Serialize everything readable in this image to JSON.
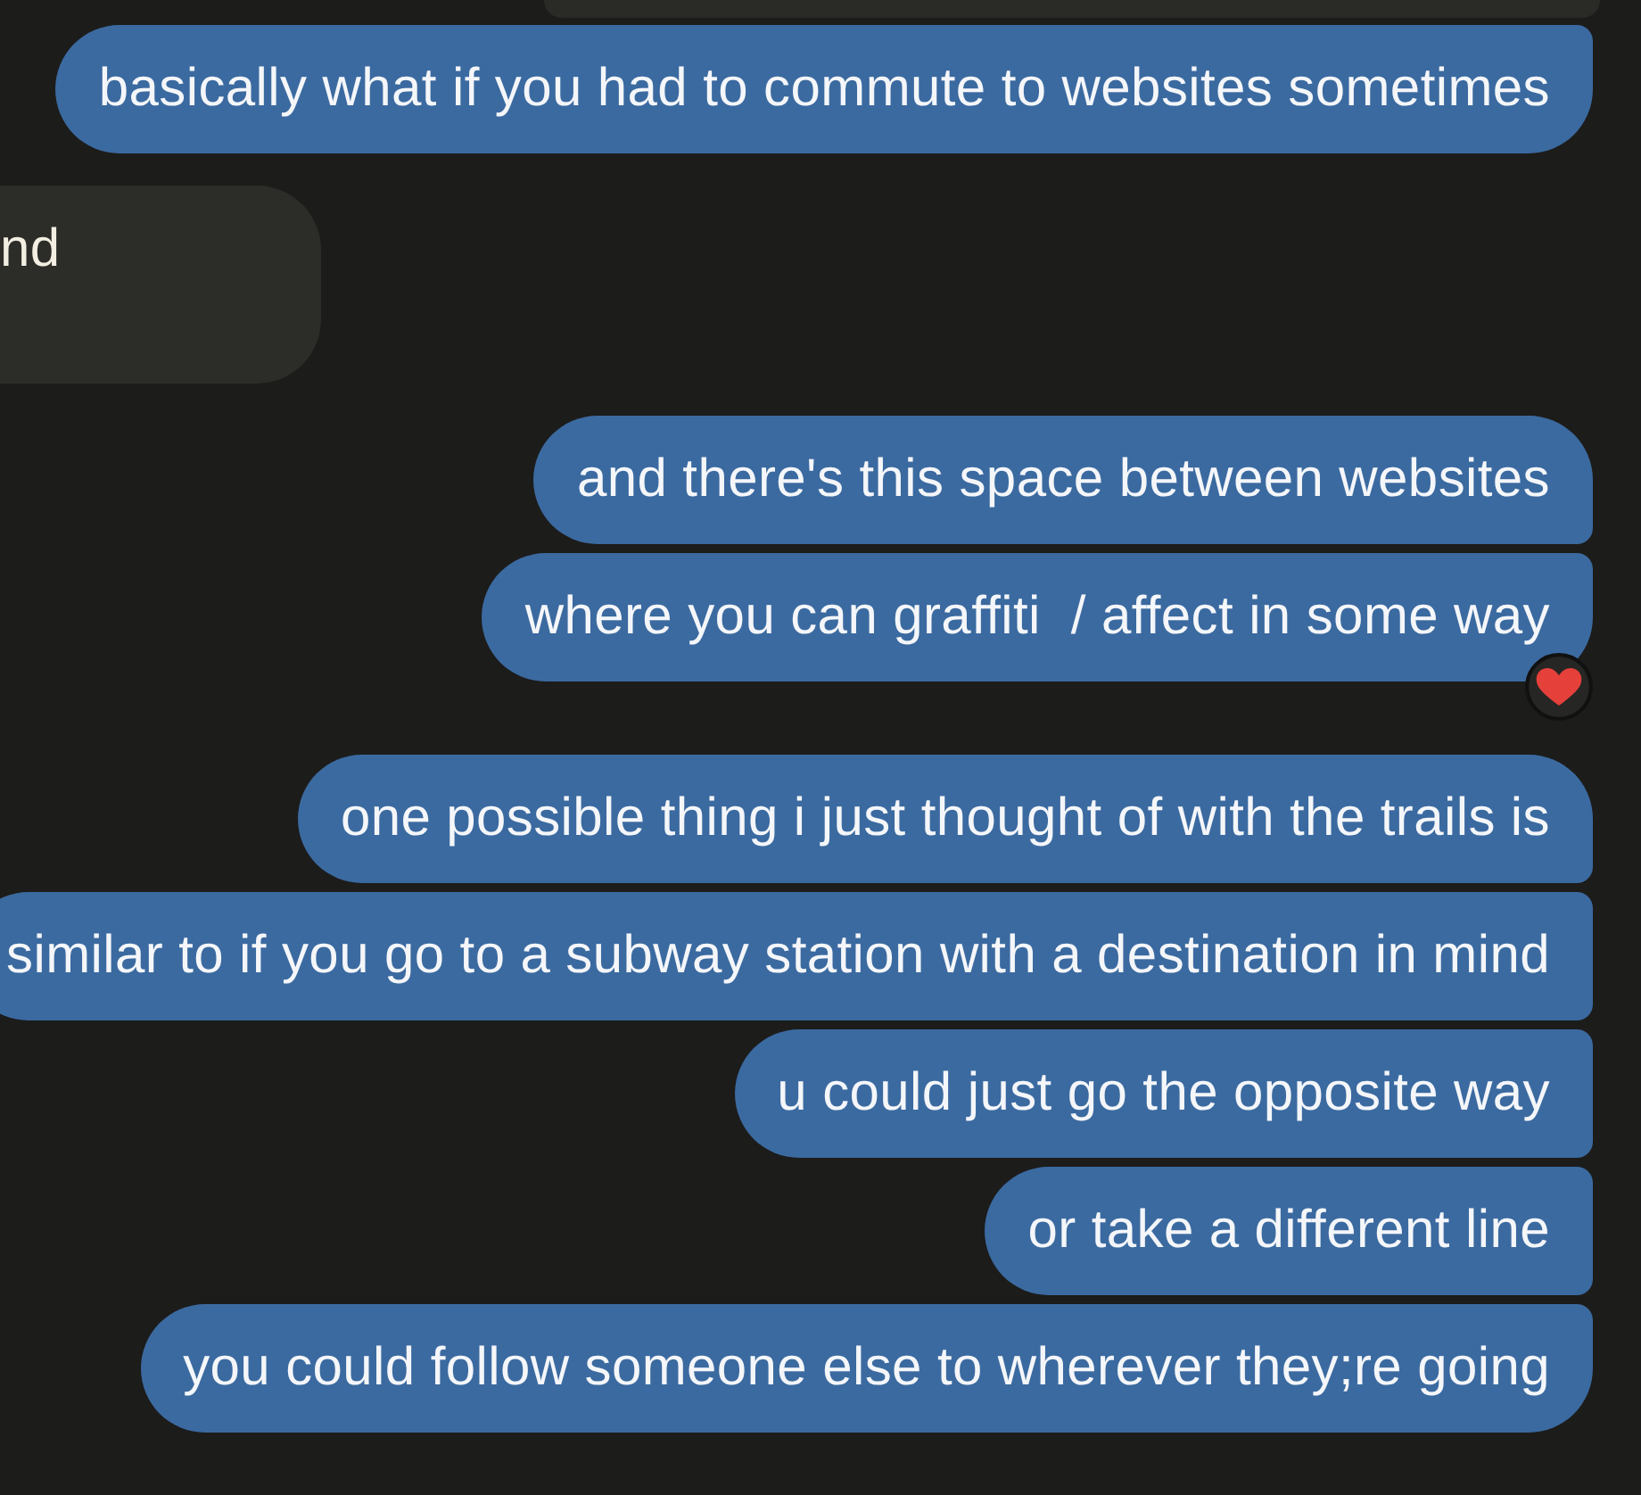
{
  "messages": [
    {
      "kind": "sent",
      "text": "basically what if you had to commute to websites sometimes",
      "reacted": false
    },
    {
      "kind": "received",
      "text": "nd",
      "reacted": false
    },
    {
      "kind": "sent",
      "text": "and there's this space between websites",
      "reacted": false
    },
    {
      "kind": "sent",
      "text": "where you can graffiti  / affect in some way",
      "reacted": true
    },
    {
      "kind": "sent",
      "text": "one possible thing i just thought of with the trails is",
      "reacted": false
    },
    {
      "kind": "sent",
      "text": "similar to if you go to a subway station with a destination in mind",
      "reacted": false
    },
    {
      "kind": "sent",
      "text": "u could just go the opposite way",
      "reacted": false
    },
    {
      "kind": "sent",
      "text": "or take a different line",
      "reacted": false
    },
    {
      "kind": "sent",
      "text": "you could follow someone else to wherever they;re going",
      "reacted": false
    }
  ]
}
